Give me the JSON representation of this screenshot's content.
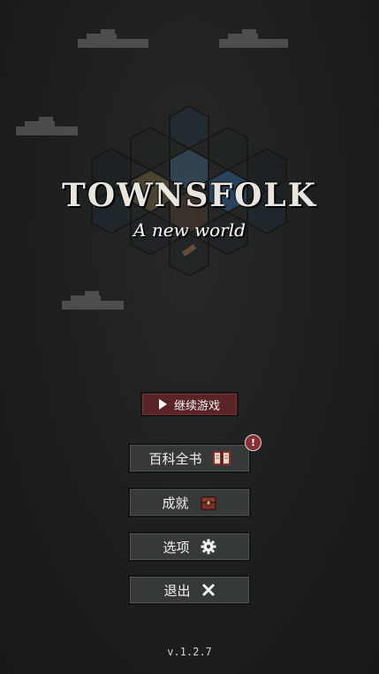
{
  "game": {
    "title": "TOWNSFOLK",
    "subtitle": "A new world",
    "version": "v.1.2.7"
  },
  "menu": {
    "continue_label": "继续游戏",
    "encyclopedia_label": "百科全书",
    "encyclopedia_badge": "!",
    "achievements_label": "成就",
    "options_label": "选项",
    "quit_label": "退出"
  },
  "icons": {
    "continue": "play-icon",
    "encyclopedia": "book-icon",
    "achievements": "chest-icon",
    "options": "gear-icon",
    "quit": "close-icon"
  },
  "colors": {
    "background": "#1c1e1d",
    "continue_button": "#5a2427",
    "menu_button": "#353a39",
    "badge": "#8c2f34"
  }
}
